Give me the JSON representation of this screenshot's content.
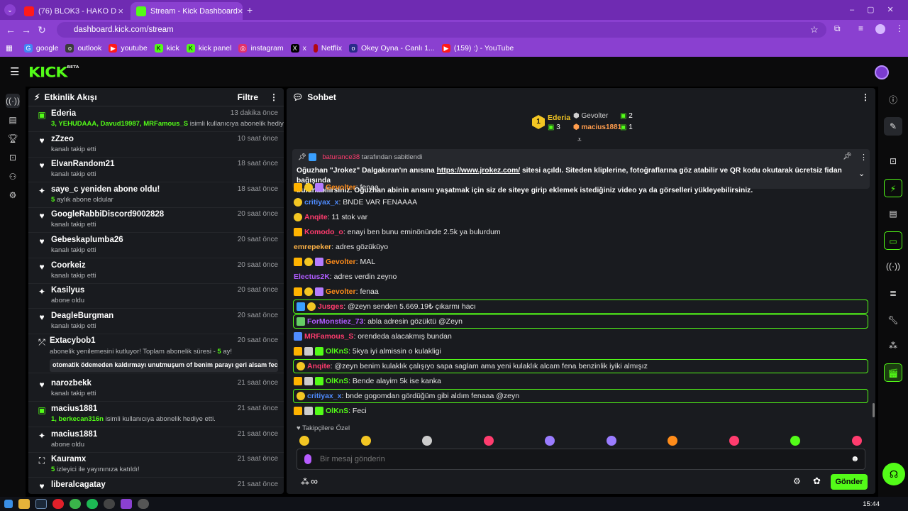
{
  "browser": {
    "tabs": [
      {
        "title": "(76) BLOK3 - HAKO DIYORLAR |",
        "close": "×"
      },
      {
        "title": "Stream - Kick Dashboard",
        "close": "×"
      }
    ],
    "new_tab": "+",
    "url": "dashboard.kick.com/stream",
    "bookmarks": [
      "google",
      "outlook",
      "youtube",
      "kick",
      "kick panel",
      "instagram",
      "x",
      "Netflix",
      "Okey Oyna - Canlı 1...",
      "(159) :) - YouTube"
    ]
  },
  "app": {
    "logo": "KICK",
    "logo_tag": "BETA"
  },
  "activity": {
    "title": "Etkinlik Akışı",
    "filter": "Filtre",
    "events": [
      {
        "icon": "gift-icon",
        "user": "Ederia",
        "time": "13 dakika önce",
        "sub_green": "3, YEHUDAAA, Davud19987, MRFamous_S",
        "sub": " isimli kullanıcıya abonelik hediye etti.",
        "green": true
      },
      {
        "icon": "heart-icon",
        "user": "zZzeo",
        "time": "10 saat önce",
        "sub": "kanalı takip etti"
      },
      {
        "icon": "heart-icon",
        "user": "ElvanRandom21",
        "time": "18 saat önce",
        "sub": "kanalı takip etti"
      },
      {
        "icon": "sparkle-icon",
        "user": "saye_c yeniden abone oldu!",
        "time": "18 saat önce",
        "sub_green": "5",
        "sub": " aylık abone oldular",
        "green": true
      },
      {
        "icon": "heart-icon",
        "user": "GoogleRabbiDiscord9002828",
        "time": "20 saat önce",
        "sub": "kanalı takip etti"
      },
      {
        "icon": "heart-icon",
        "user": "Gebeskaplumba26",
        "time": "20 saat önce",
        "sub": "kanalı takip etti"
      },
      {
        "icon": "heart-icon",
        "user": "Coorkeiz",
        "time": "20 saat önce",
        "sub": "kanalı takip etti"
      },
      {
        "icon": "sparkle-icon",
        "user": "Kasilyus",
        "time": "20 saat önce",
        "sub": "abone oldu"
      },
      {
        "icon": "heart-icon",
        "user": "DeagleBurgman",
        "time": "20 saat önce",
        "sub": "kanalı takip etti"
      }
    ],
    "resub": {
      "user": "Extacybob1",
      "time": "20 saat önce",
      "line": "abonelik yenilemesini kutluyor! Toplam abonelik süresi - ",
      "months": "5",
      "suffix": " ay!",
      "message": "otomatik ödemeden kaldırmayı unutmuşum of benim parayı geri alsam feci"
    },
    "events2": [
      {
        "icon": "heart-icon",
        "user": "narozbekk",
        "time": "21 saat önce",
        "sub": "kanalı takip etti"
      },
      {
        "icon": "gift-icon",
        "user": "macius1881",
        "time": "21 saat önce",
        "sub_green": "1, berkecan316n",
        "sub": " isimli kullanıcıya abonelik hediye etti.",
        "green": true
      },
      {
        "icon": "sparkle-icon",
        "user": "macius1881",
        "time": "21 saat önce",
        "sub": "abone oldu"
      },
      {
        "icon": "host-icon",
        "user": "Kauramx",
        "time": "21 saat önce",
        "sub_green": "5",
        "sub": " izleyici ile yayınınıza katıldı!",
        "green": true
      },
      {
        "icon": "heart-icon",
        "user": "liberalcagatay",
        "time": "21 saat önce",
        "sub": ""
      }
    ]
  },
  "chat": {
    "title": "Sohbet",
    "leaderboard": [
      {
        "rank": "1",
        "name": "Ederia",
        "count": "3"
      },
      {
        "rank": "",
        "name": "Gevolter",
        "count": "2"
      },
      {
        "rank": "",
        "name": "macius1881",
        "count": "1"
      }
    ],
    "pinned": {
      "by_user": "baturance38",
      "by_label": " tarafından sabitlendi",
      "text1": "Oğuzhan \"Jrokez\" Dalgakıran'ın anısına ",
      "link": "https://www.jrokez.com/",
      "text2": " sitesi açıldı. Siteden kliplerine, fotoğraflarına göz atabilir ve QR kodu okutarak ücretsiz fidan bağışında",
      "text3": "bulunabilirsiniz. Oğuzhan abinin anısını yaşatmak için siz de siteye girip eklemek istediğiniz video ya da görselleri yükleyebilirsiniz."
    },
    "messages": [
      {
        "user": "Gevolter",
        "color": "#ff8c1a",
        "text": ": fenaa",
        "badges": [
          "#ffb300",
          "#f3c623",
          "#b57cff"
        ],
        "hl": false
      },
      {
        "user": "critiyax_x",
        "color": "#4f8cff",
        "text": ": BNDE VAR FENAAAA",
        "badges": [
          "#f3c623"
        ],
        "hl": false
      },
      {
        "user": "Anqite",
        "color": "#ff3c6e",
        "text": ": 11 stok var",
        "badges": [
          "#f3c623"
        ],
        "hl": false
      },
      {
        "user": "Komodo_o",
        "color": "#ff3c6e",
        "text": ": enayi ben bunu eminönünde 2.5k ya bulurdum",
        "badges": [
          "#ffb300"
        ],
        "hl": false
      },
      {
        "user": "emrepeker",
        "color": "#ffb347",
        "text": ": adres gözüküyo",
        "badges": [],
        "hl": false
      },
      {
        "user": "Gevolter",
        "color": "#ff8c1a",
        "text": ": MAL",
        "badges": [
          "#ffb300",
          "#f3c623",
          "#b57cff"
        ],
        "hl": false
      },
      {
        "user": "Electus2K",
        "color": "#b05cff",
        "text": ": adres verdin zeyno",
        "badges": [],
        "hl": false
      },
      {
        "user": "Gevolter",
        "color": "#ff8c1a",
        "text": ": fenaa",
        "badges": [
          "#ffb300",
          "#f3c623",
          "#b57cff"
        ],
        "hl": false
      },
      {
        "user": "Jusges",
        "color": "#ff3c6e",
        "text": ": @zeyn senden 5.669.19₺ çıkarmı hacı",
        "badges": [
          "#3aa0ff",
          "#f3c623"
        ],
        "hl": true
      },
      {
        "user": "ForMonstiez_73",
        "color": "#b05cff",
        "text": ": abla adresin gözüktü @Zeyn",
        "badges": [
          "#66cc66"
        ],
        "hl": true
      },
      {
        "user": "MRFamous_S",
        "color": "#ff3c6e",
        "text": ": orendeda alacakmış bundan",
        "badges": [
          "#4f8cff"
        ],
        "hl": false
      },
      {
        "user": "OlKnS",
        "color": "#53fc18",
        "text": ": 5kya iyi almissin o kulakligi",
        "badges": [
          "#ffb300",
          "#cccccc",
          "#53fc18"
        ],
        "hl": false
      },
      {
        "user": "Anqite",
        "color": "#ff3c6e",
        "text": ": @zeyn benim kulaklık çalışıyo sapa saglam ama yeni kulaklık alcam fena benzinlik iyiki almışız",
        "badges": [
          "#f3c623"
        ],
        "hl": true
      },
      {
        "user": "OlKnS",
        "color": "#53fc18",
        "text": ": Bende alayim 5k ise kanka",
        "badges": [
          "#ffb300",
          "#cccccc",
          "#53fc18"
        ],
        "hl": false
      },
      {
        "user": "critiyax_x",
        "color": "#4f8cff",
        "text": ": bnde gogomdan gördüğüm gibi aldım fenaaa @zeyn",
        "badges": [
          "#f3c623"
        ],
        "hl": true
      },
      {
        "user": "OlKnS",
        "color": "#53fc18",
        "text": ": Feci",
        "badges": [
          "#ffb300",
          "#cccccc",
          "#53fc18"
        ],
        "hl": false
      }
    ],
    "followers_only": "Takipçilere Özel",
    "input_placeholder": "Bir mesaj gönderin",
    "send": "Gönder",
    "infinity": "∞"
  },
  "taskbar": {
    "time": "15:44"
  }
}
